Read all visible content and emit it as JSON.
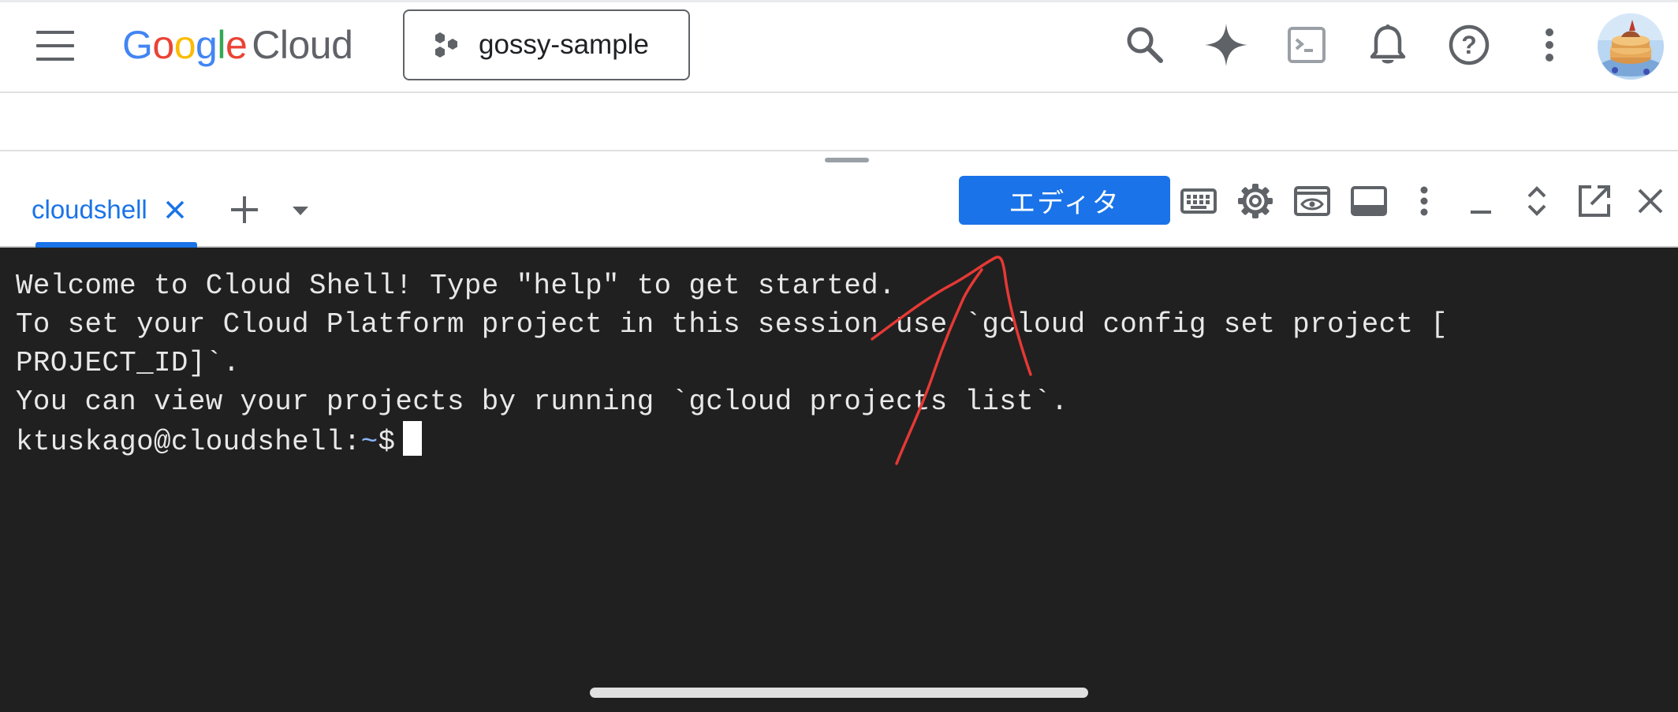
{
  "header": {
    "logo_google": "Google",
    "logo_cloud": "Cloud",
    "project_name": "gossy-sample",
    "icons": [
      "menu-icon",
      "search-icon",
      "gemini-sparkle-icon",
      "cloud-shell-icon",
      "bell-icon",
      "help-icon",
      "more-vert-icon",
      "avatar"
    ]
  },
  "shell": {
    "tab_label": "cloudshell",
    "editor_button": "エディタ",
    "icons": [
      "add-icon",
      "arrow-drop-down-icon",
      "keyboard-icon",
      "settings-icon",
      "web-preview-icon",
      "layout-icon",
      "more-vert-icon",
      "minimize-icon",
      "expand-icon",
      "open-new-window-icon",
      "close-icon"
    ]
  },
  "terminal": {
    "line1": "Welcome to Cloud Shell! Type \"help\" to get started.",
    "line2": "To set your Cloud Platform project in this session use `gcloud config set project [",
    "line3": "PROJECT_ID]`.",
    "line4": "You can view your projects by running `gcloud projects list`.",
    "prompt_user": "ktuskago@cloudshell:",
    "prompt_path": "~",
    "prompt_symbol": "$"
  },
  "colors": {
    "accent": "#1a73e8",
    "terminal_bg": "#202020",
    "terminal_fg": "#e8e8e8",
    "annotation": "#e53935"
  }
}
